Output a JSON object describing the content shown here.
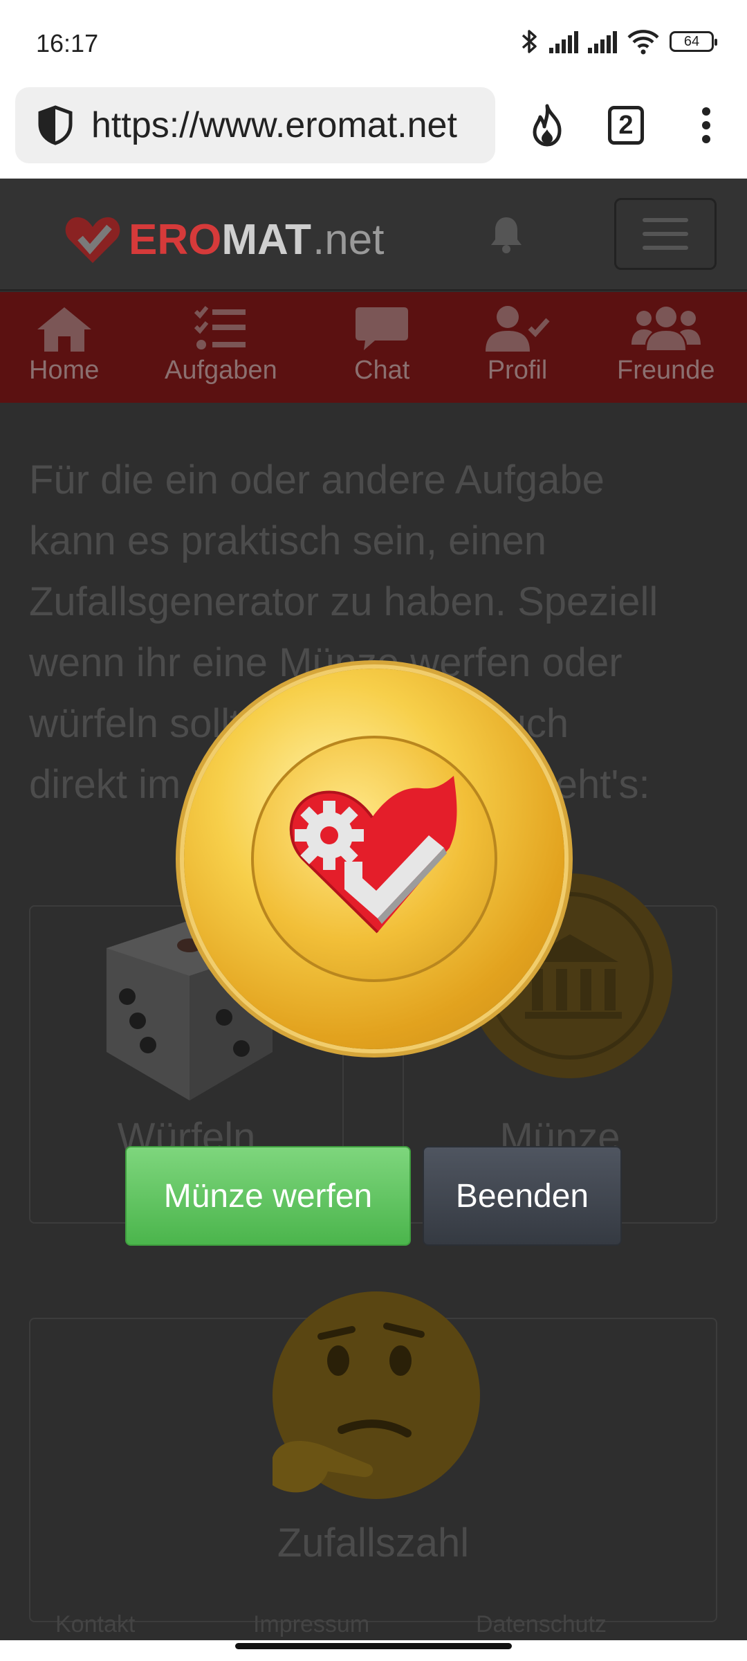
{
  "status_bar": {
    "time": "16:17",
    "battery": "64",
    "icons": [
      "bluetooth-icon",
      "signal-icon",
      "signal-icon",
      "wifi-icon",
      "battery-icon"
    ]
  },
  "browser": {
    "url": "https://www.eromat.net",
    "tab_count": "2",
    "icons": [
      "shield-icon",
      "flame-icon",
      "tabs-icon",
      "more-vertical-icon"
    ]
  },
  "site": {
    "logo": {
      "ero": "ERO",
      "mat": "MAT",
      "net": ".net"
    },
    "nav": [
      {
        "label": "Home",
        "icon": "home-icon"
      },
      {
        "label": "Aufgaben",
        "icon": "tasks-icon"
      },
      {
        "label": "Chat",
        "icon": "chat-icon"
      },
      {
        "label": "Profil",
        "icon": "profile-icon"
      },
      {
        "label": "Freunde",
        "icon": "friends-icon"
      }
    ],
    "intro_lines": [
      "Für die ein oder andere Aufgabe",
      "kann es praktisch sein, einen",
      "Zufallsgenerator zu haben. Speziell",
      "wenn ihr eine Münze werfen oder",
      "würfeln sollt, könnt ihr es auch",
      "direkt im Portal machen. So geht's:"
    ],
    "cards": [
      {
        "label": "Würfeln",
        "icon": "dice-icon"
      },
      {
        "label": "Münze",
        "icon": "coin-icon"
      },
      {
        "label": "Zufallszahl",
        "icon": "thinking-face-icon"
      }
    ],
    "footer": [
      "Kontakt",
      "Impressum",
      "Datenschutz"
    ]
  },
  "modal": {
    "coin_icon": "heart-check-icon",
    "flip_button": "Münze werfen",
    "close_button": "Beenden"
  }
}
